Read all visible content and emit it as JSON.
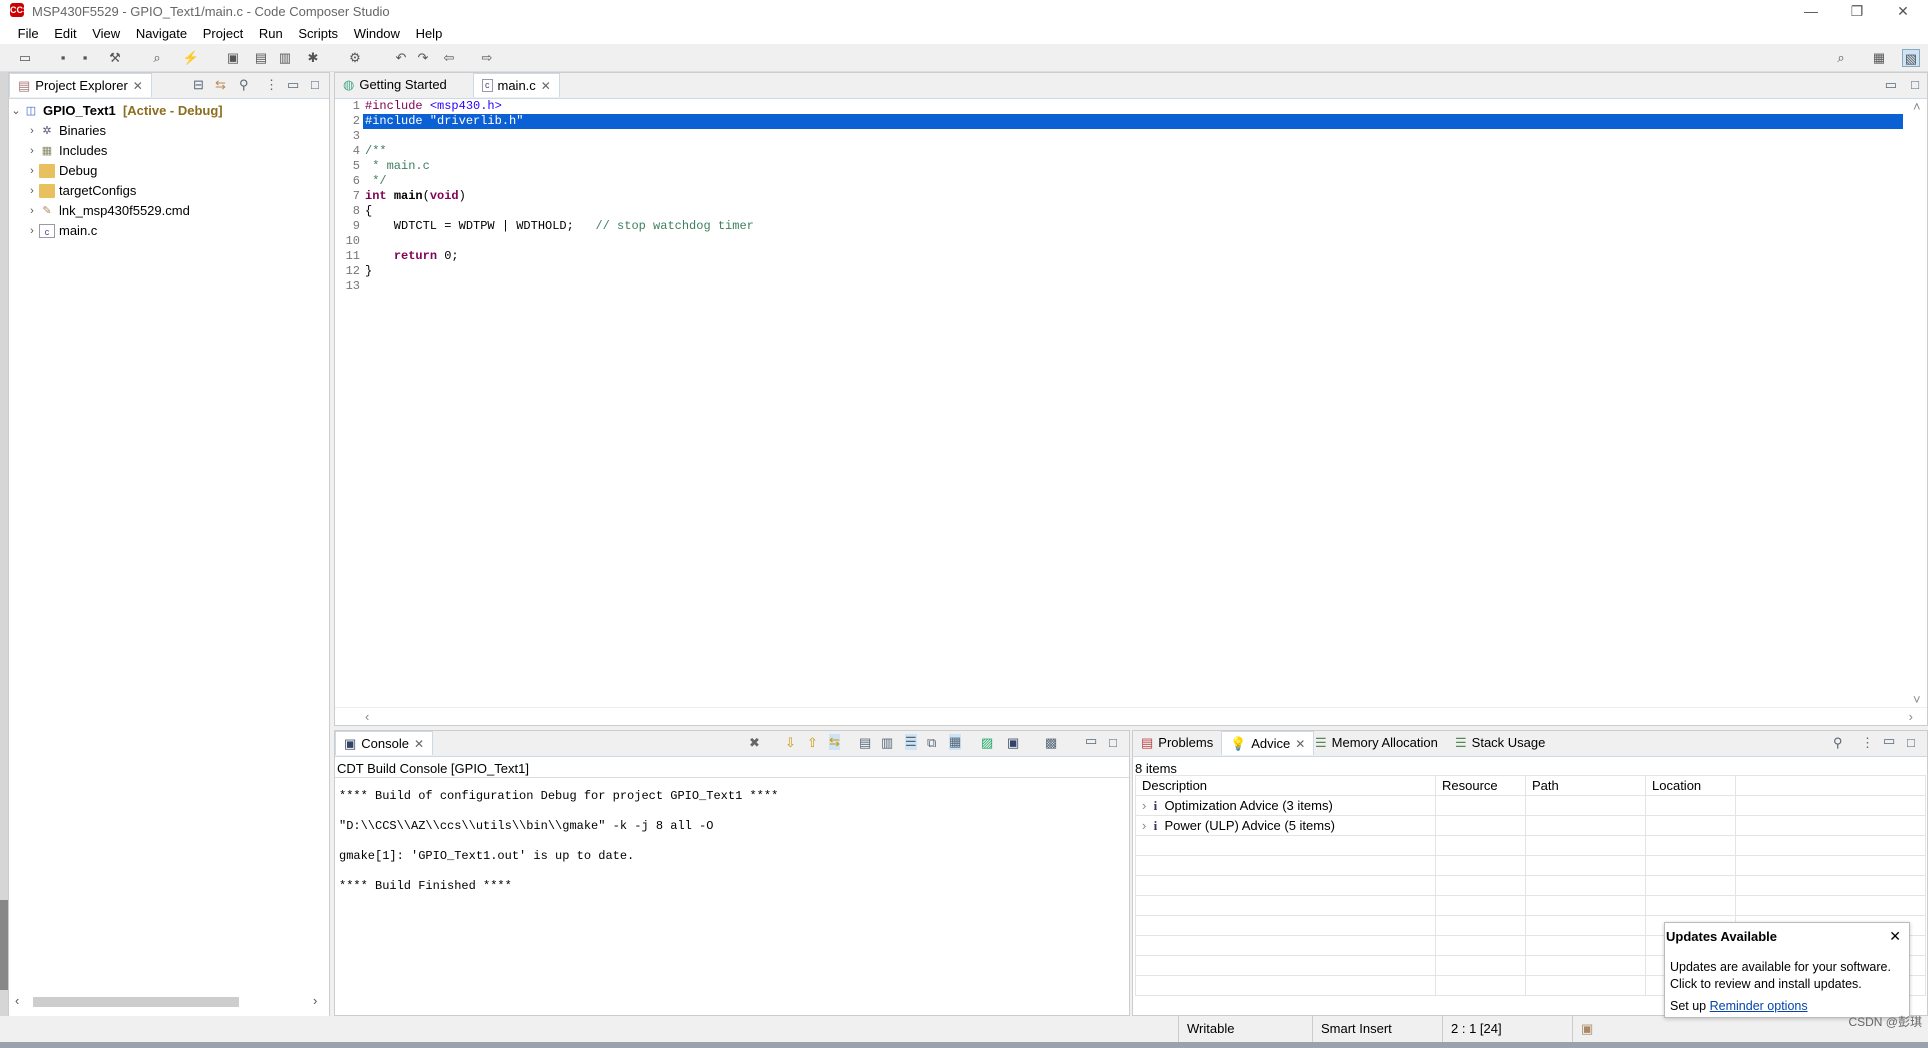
{
  "window": {
    "title": "MSP430F5529 - GPIO_Text1/main.c - Code Composer Studio",
    "logo": "CCS"
  },
  "menu": [
    "File",
    "Edit",
    "View",
    "Navigate",
    "Project",
    "Run",
    "Scripts",
    "Window",
    "Help"
  ],
  "project_explorer": {
    "tab": "Project Explorer",
    "project": "GPIO_Text1",
    "project_state": "[Active - Debug]",
    "items": [
      "Binaries",
      "Includes",
      "Debug",
      "targetConfigs",
      "lnk_msp430f5529.cmd",
      "main.c"
    ]
  },
  "editor": {
    "tabs": [
      "Getting Started",
      "main.c"
    ],
    "lines": [
      {
        "n": "1",
        "html": "<span class='pp'>#include</span> <span class='str'>&lt;msp430.h&gt;</span>"
      },
      {
        "n": "2",
        "html": "#include \"driverlib.h\"",
        "selected": true
      },
      {
        "n": "3",
        "html": ""
      },
      {
        "n": "4",
        "html": "<span class='cm'>/**</span>"
      },
      {
        "n": "5",
        "html": "<span class='cm'> * main.c</span>"
      },
      {
        "n": "6",
        "html": "<span class='cm'> */</span>"
      },
      {
        "n": "7",
        "html": "<span class='kw'>int</span> <b>main</b>(<span class='kw'>void</span>)"
      },
      {
        "n": "8",
        "html": "{"
      },
      {
        "n": "9",
        "html": "    WDTCTL = WDTPW | WDTHOLD;   <span class='cm'>// stop watchdog timer</span>"
      },
      {
        "n": "10",
        "html": ""
      },
      {
        "n": "11",
        "html": "    <span class='kw'>return</span> 0;"
      },
      {
        "n": "12",
        "html": "}"
      },
      {
        "n": "13",
        "html": ""
      }
    ]
  },
  "console": {
    "tab": "Console",
    "subtitle": "CDT Build Console [GPIO_Text1]",
    "lines": [
      "**** Build of configuration Debug for project GPIO_Text1 ****",
      "\"D:\\\\CCS\\\\AZ\\\\ccs\\\\utils\\\\bin\\\\gmake\" -k -j 8 all -O",
      "gmake[1]: 'GPIO_Text1.out' is up to date.",
      "**** Build Finished ****"
    ]
  },
  "advice": {
    "tabs": [
      "Problems",
      "Advice",
      "Memory Allocation",
      "Stack Usage"
    ],
    "count": "8 items",
    "columns": [
      "Description",
      "Resource",
      "Path",
      "Location"
    ],
    "rows": [
      "Optimization Advice (3 items)",
      "Power (ULP) Advice (5 items)"
    ]
  },
  "status": {
    "writable": "Writable",
    "insert": "Smart Insert",
    "position": "2 : 1 [24]"
  },
  "popup": {
    "title": "Updates Available",
    "line1": "Updates are available for your software.",
    "line2": "Click to review and install updates.",
    "prefix": "Set up ",
    "link": "Reminder options"
  },
  "watermark": "CSDN @彭琪"
}
